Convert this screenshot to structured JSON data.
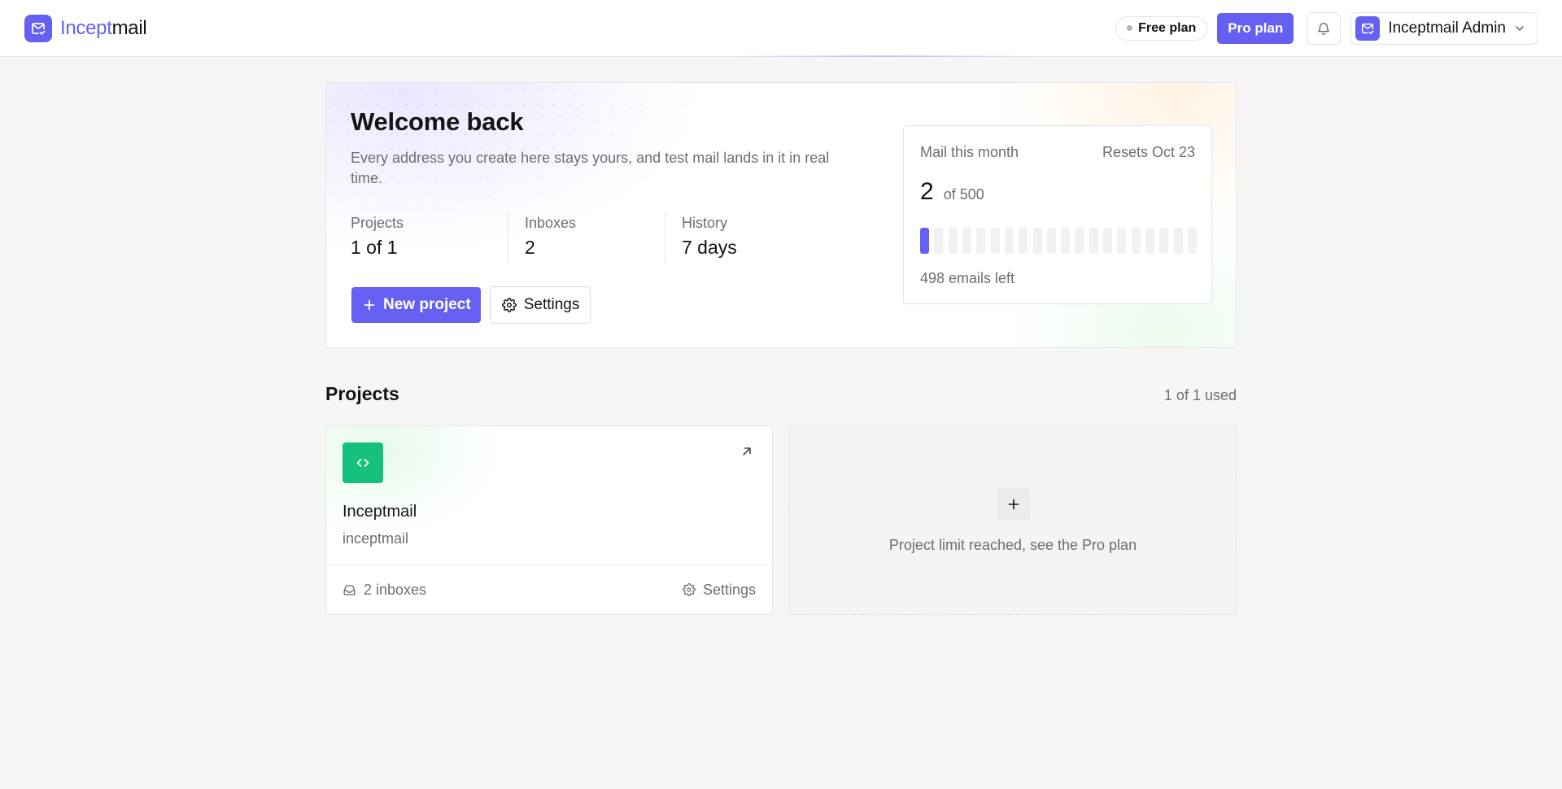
{
  "brand": {
    "name_accent": "Incept",
    "name_rest": "mail",
    "color": "#6560f2"
  },
  "header": {
    "free_plan_label": "Free plan",
    "pro_plan_label": "Pro plan",
    "account_name": "Inceptmail Admin",
    "icons": [
      "mail-check-icon",
      "bell-icon",
      "chevron-down-icon"
    ]
  },
  "hero": {
    "title": "Welcome back",
    "subtitle": "Every address you create here stays yours, and test mail lands in it in real time.",
    "stats": [
      {
        "label": "Projects",
        "value": "1 of 1"
      },
      {
        "label": "Inboxes",
        "value": "2"
      },
      {
        "label": "History",
        "value": "7 days"
      }
    ],
    "new_project_label": "New project",
    "settings_label": "Settings"
  },
  "usage": {
    "title": "Mail this month",
    "resets": "Resets Oct 23",
    "count": "2",
    "of_label": "of 500",
    "used": 2,
    "limit": 500,
    "segments": 20,
    "remaining_label": "498 emails left"
  },
  "projects": {
    "title": "Projects",
    "count_label": "1 of 1 used",
    "items": [
      {
        "name": "Inceptmail",
        "slug": "inceptmail",
        "icon": "code-icon",
        "icon_color": "#16c07d",
        "inboxes_label": "2 inboxes",
        "settings_label": "Settings"
      }
    ],
    "limit_message": "Project limit reached, see the Pro plan"
  }
}
